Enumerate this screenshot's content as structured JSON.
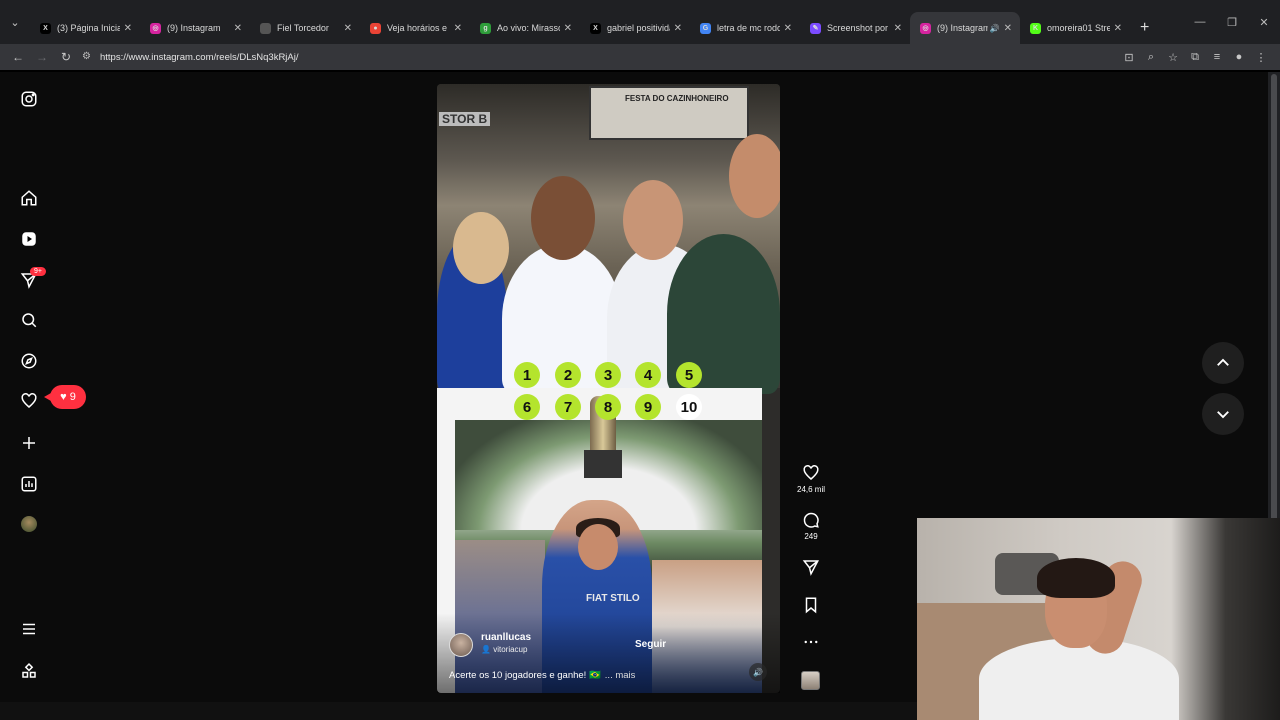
{
  "browser": {
    "tabs": [
      {
        "title": "(3) Página Inicial /",
        "fav": "X",
        "favColor": "#000000",
        "active": false
      },
      {
        "title": "(9) Instagram",
        "fav": "◎",
        "favColor": "#d6249f",
        "active": false
      },
      {
        "title": "Fiel Torcedor",
        "fav": "",
        "favColor": "#555555",
        "active": false
      },
      {
        "title": "Veja horários e lo",
        "fav": "●",
        "favColor": "#ea4335",
        "active": false
      },
      {
        "title": "Ao vivo: Mirassol",
        "fav": "g",
        "favColor": "#2e9d3a",
        "active": false
      },
      {
        "title": "gabriel positivida",
        "fav": "X",
        "favColor": "#000000",
        "active": false
      },
      {
        "title": "letra de mc rodol",
        "fav": "G",
        "favColor": "#4285f4",
        "active": false
      },
      {
        "title": "Screenshot por Li",
        "fav": "✎",
        "favColor": "#7b4bff",
        "active": false
      },
      {
        "title": "(9) Instagram",
        "fav": "◎",
        "favColor": "#d6249f",
        "active": true
      },
      {
        "title": "omoreira01 Strea",
        "fav": "K",
        "favColor": "#53fc18",
        "active": false
      }
    ],
    "url": "https://www.instagram.com/reels/DLsNq3kRjAj/"
  },
  "sidebar": {
    "direct_badge": "9+",
    "notifications_count": "9"
  },
  "reel": {
    "banner_text": "FESTA DO CAZINHONEIRO",
    "wall_text": "STOR B",
    "numbers_row1": [
      "1",
      "2",
      "3",
      "4",
      "5"
    ],
    "numbers_row2": [
      "6",
      "7",
      "8",
      "9",
      "10"
    ],
    "shirt_text": "FIAT STILO",
    "author": "ruanllucas",
    "collaborator": "vitoriacup",
    "follow_label": "Seguir",
    "caption": "Acerte os 10 jogadores e ganhe! 🇧🇷",
    "more_label": "... mais"
  },
  "actions": {
    "likes": "24,6 mil",
    "comments": "249"
  },
  "colors": {
    "accent_red": "#ff3040",
    "number_green": "#b4e42d"
  }
}
